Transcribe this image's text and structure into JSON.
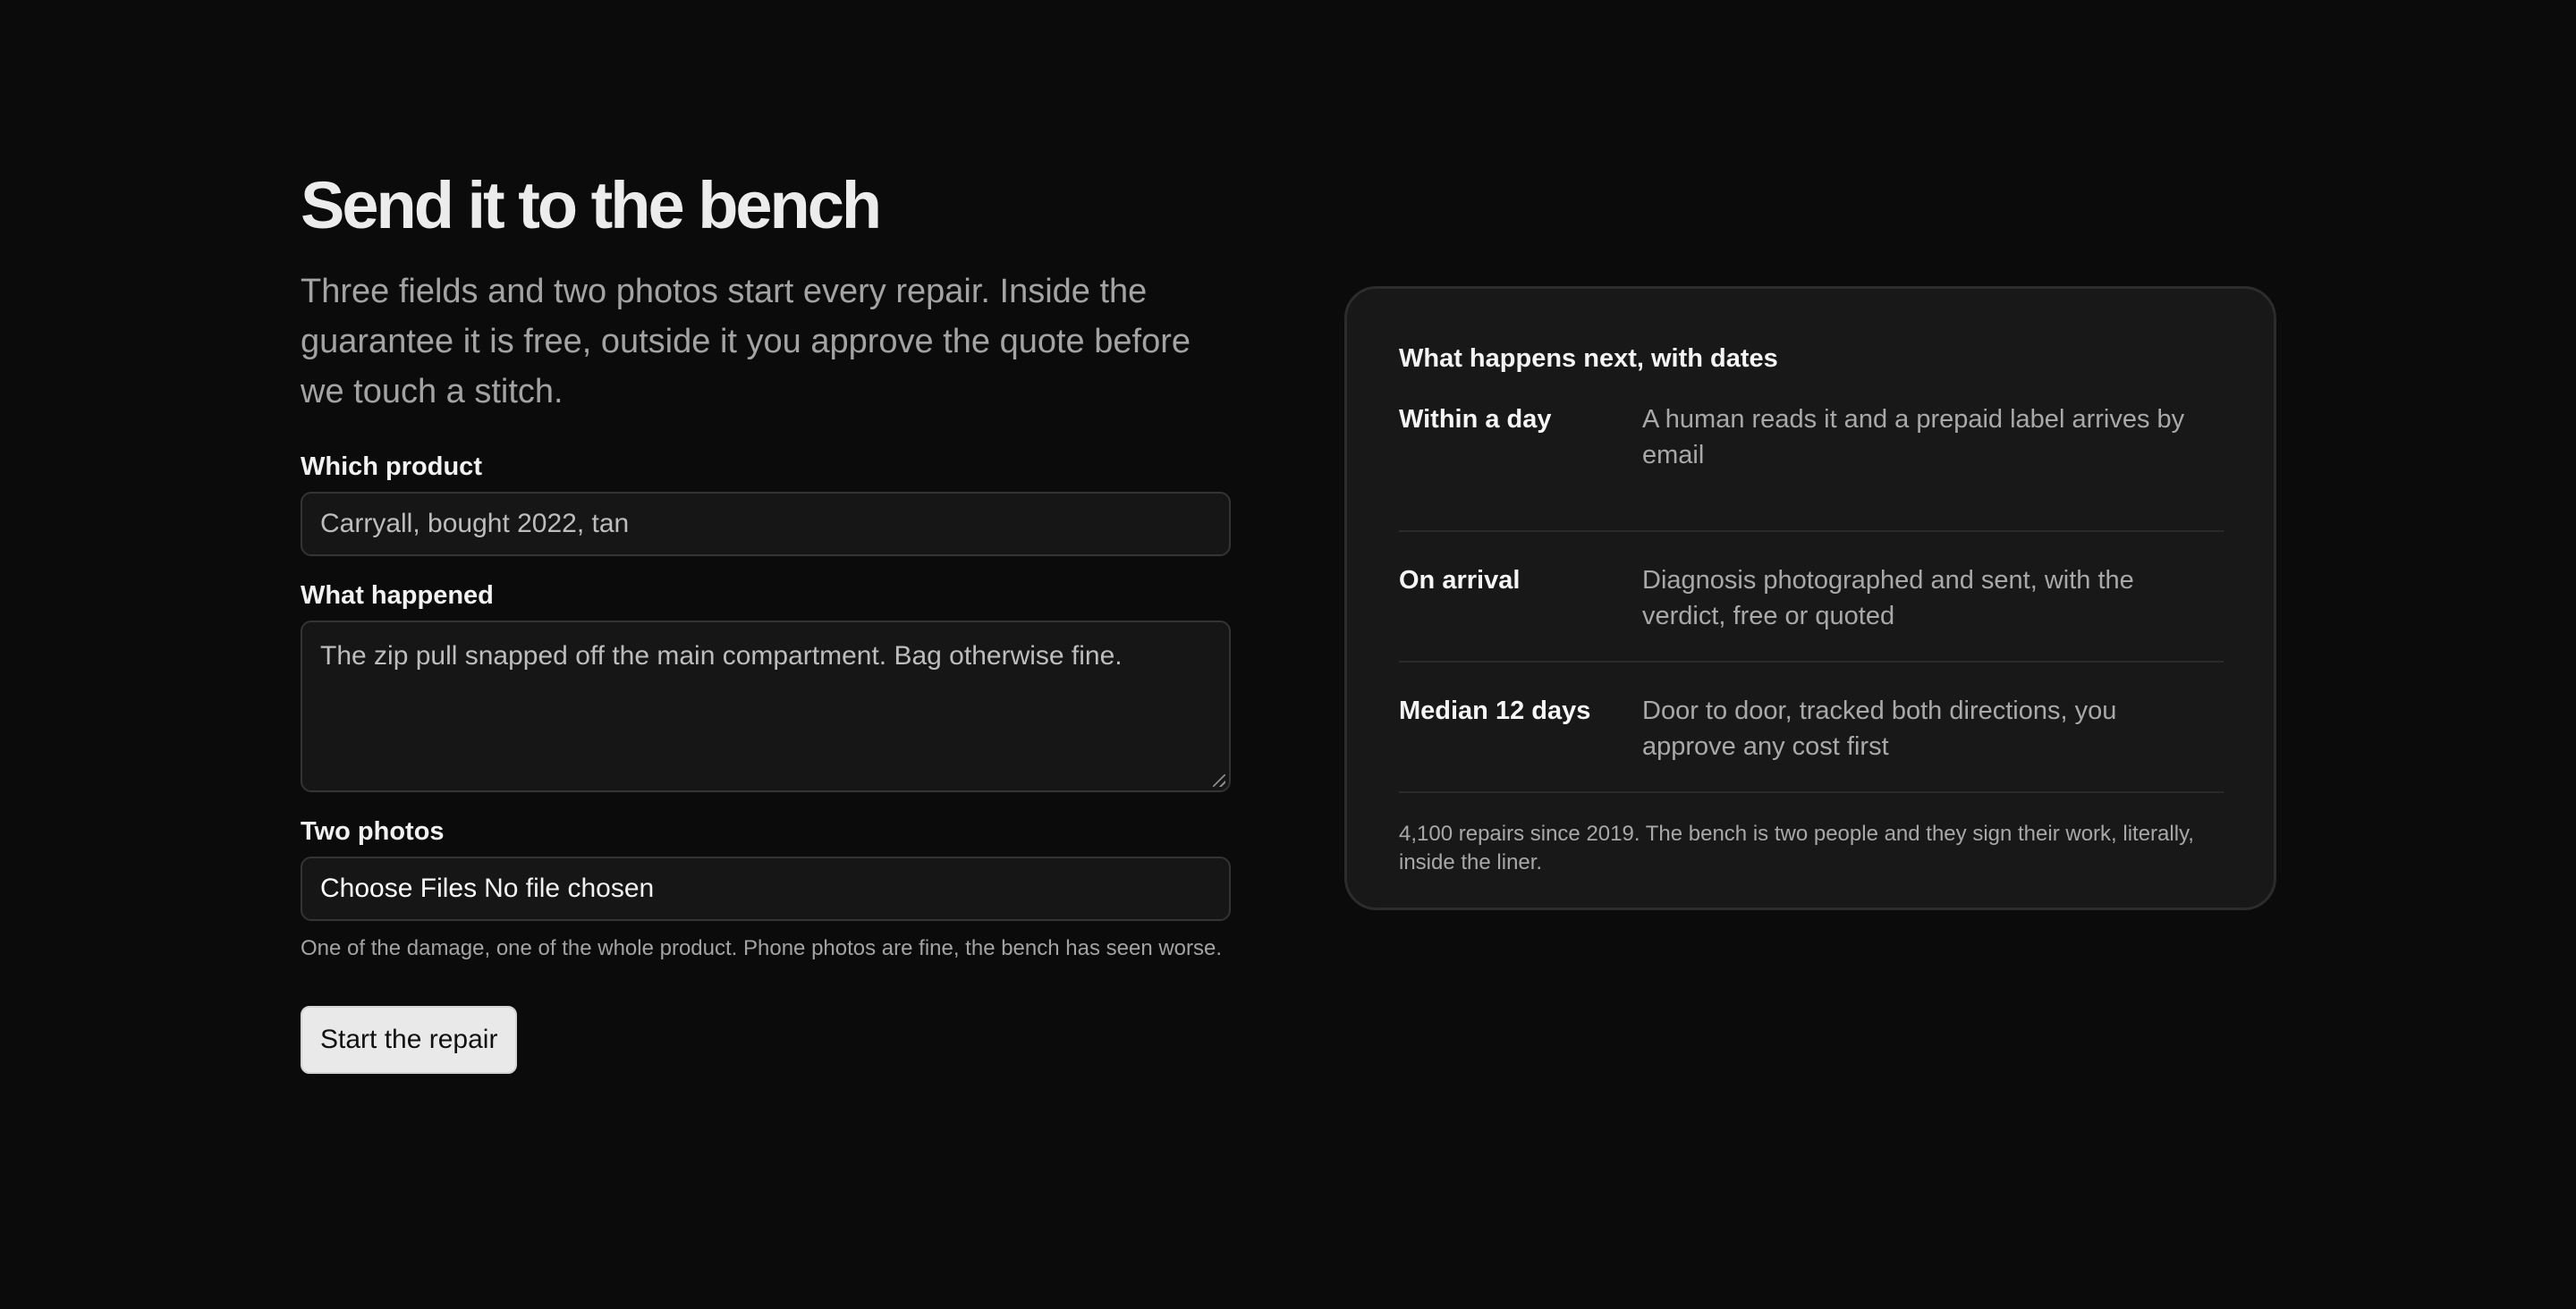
{
  "form": {
    "title": "Send it to the bench",
    "lede": "Three fields and two photos start every repair. Inside the guarantee it is free, outside it you approve the quote before we touch a stitch.",
    "product": {
      "label": "Which product",
      "value": "Carryall, bought 2022, tan"
    },
    "happened": {
      "label": "What happened",
      "value": "The zip pull snapped off the main compartment. Bag otherwise fine."
    },
    "photos": {
      "label": "Two photos",
      "choose_label": "Choose Files",
      "status": "No file chosen",
      "hint": "One of the damage, one of the whole product. Phone photos are fine, the bench has seen worse."
    },
    "submit_label": "Start the repair"
  },
  "card": {
    "title": "What happens next, with dates",
    "rows": [
      {
        "key": "Within a day",
        "value": "A human reads it and a prepaid label arrives by email"
      },
      {
        "key": "On arrival",
        "value": "Diagnosis photographed and sent, with the verdict, free or quoted"
      },
      {
        "key": "Median 12 days",
        "value": "Door to door, tracked both directions, you approve any cost first"
      }
    ],
    "footnote": "4,100 repairs since 2019. The bench is two people and they sign their work, literally, inside the liner."
  },
  "colors": {
    "background": "#0b0b0b",
    "card": "#181818",
    "button": "#e9e9e9"
  }
}
